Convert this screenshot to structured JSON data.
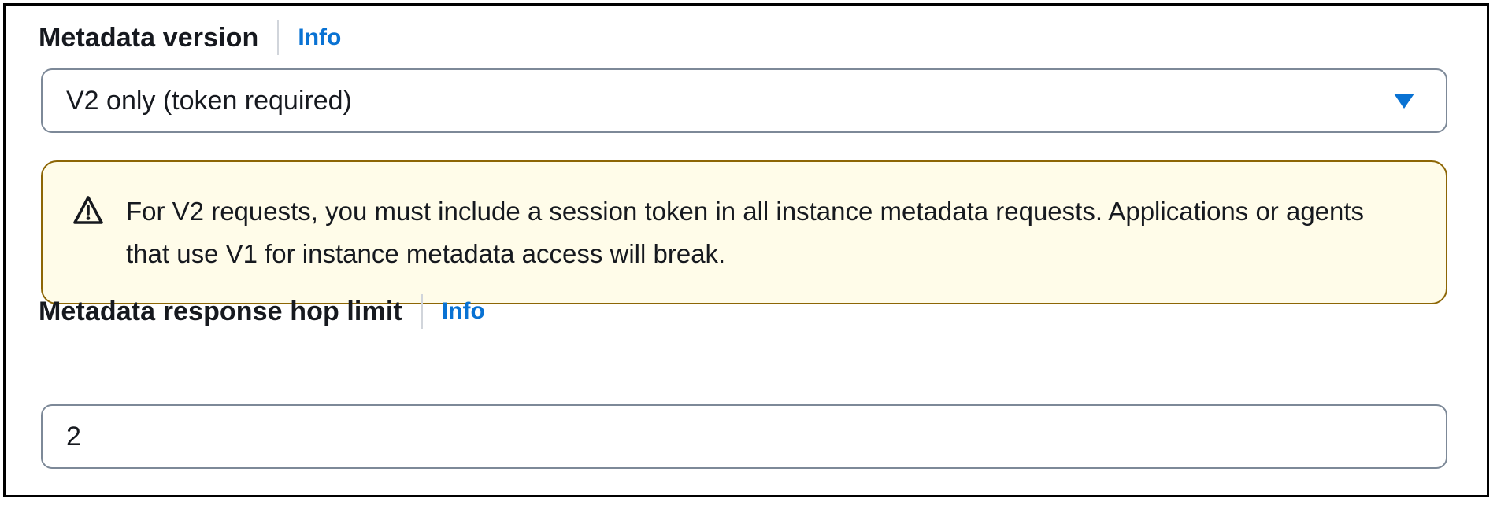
{
  "metadata_version": {
    "label": "Metadata version",
    "info_link": "Info",
    "selected_value": "V2 only (token required)"
  },
  "warning_alert": {
    "icon": "warning-triangle-icon",
    "message": "For V2 requests, you must include a session token in all instance metadata requests. Applications or agents that use V1 for instance metadata access will break."
  },
  "hop_limit": {
    "label": "Metadata response hop limit",
    "info_link": "Info",
    "value": "2"
  },
  "colors": {
    "link": "#0972d3",
    "text": "#16191f",
    "input_border": "#7d8998",
    "warning_border": "#8d6605",
    "warning_background": "#fffce9"
  }
}
